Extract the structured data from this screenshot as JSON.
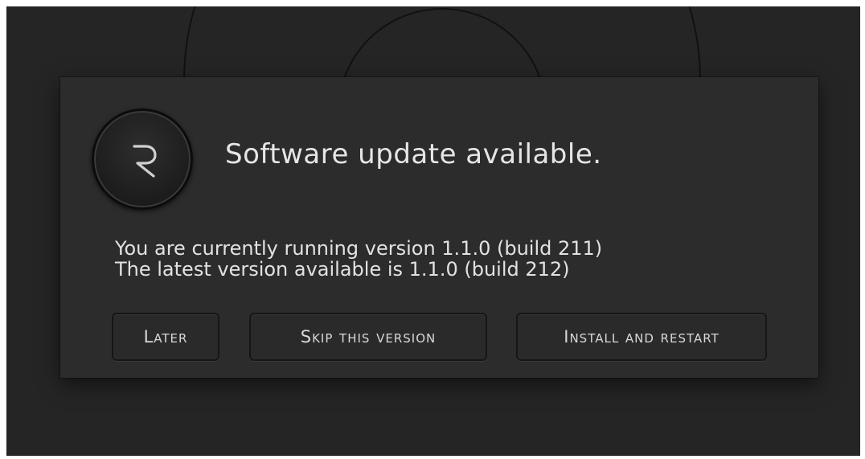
{
  "dialog": {
    "title": "Software update available.",
    "current_version_line": "You are currently running version 1.1.0 (build 211)",
    "latest_version_line": "The latest version available is 1.1.0 (build 212)",
    "buttons": {
      "later": "Later",
      "skip": "Skip this version",
      "install": "Install and restart"
    },
    "app_icon": "app-logo-r-icon"
  },
  "colors": {
    "background": "#252525",
    "dialog": "#2c2c2c",
    "text": "#e6e6e6",
    "button_border": "#161616"
  }
}
